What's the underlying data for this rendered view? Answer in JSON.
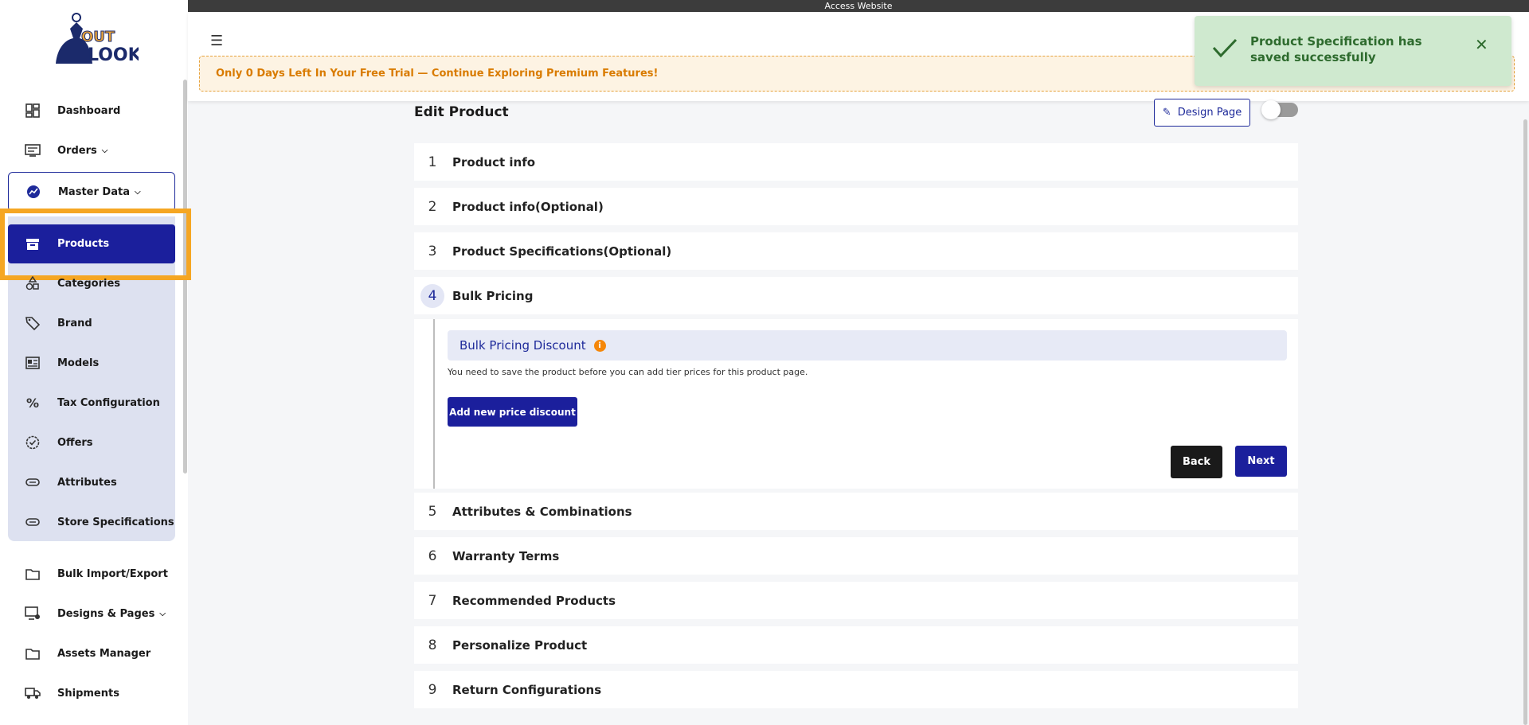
{
  "topbar": {
    "text": "Access Website"
  },
  "sidebar": {
    "items": [
      {
        "label": "Dashboard"
      },
      {
        "label": "Orders"
      },
      {
        "label": "Master Data"
      },
      {
        "label": "Products"
      },
      {
        "label": "Categories"
      },
      {
        "label": "Brand"
      },
      {
        "label": "Models"
      },
      {
        "label": "Tax Configuration"
      },
      {
        "label": "Offers"
      },
      {
        "label": "Attributes"
      },
      {
        "label": "Store Specifications"
      },
      {
        "label": "Bulk Import/Export"
      },
      {
        "label": "Designs & Pages"
      },
      {
        "label": "Assets Manager"
      },
      {
        "label": "Shipments"
      }
    ]
  },
  "banner": {
    "trial_text": "Only 0 Days Left In Your Free Trial — Continue Exploring Premium Features!"
  },
  "toast": {
    "message": "Product Specification has saved successfully"
  },
  "page": {
    "title": "Edit Product",
    "design_button": "Design Page"
  },
  "steps": [
    {
      "num": "1",
      "label": "Product info"
    },
    {
      "num": "2",
      "label": "Product info(Optional)"
    },
    {
      "num": "3",
      "label": "Product Specifications(Optional)"
    },
    {
      "num": "4",
      "label": "Bulk Pricing"
    },
    {
      "num": "5",
      "label": "Attributes & Combinations"
    },
    {
      "num": "6",
      "label": "Warranty Terms"
    },
    {
      "num": "7",
      "label": "Recommended Products"
    },
    {
      "num": "8",
      "label": "Personalize Product"
    },
    {
      "num": "9",
      "label": "Return Configurations"
    }
  ],
  "bulk": {
    "heading": "Bulk Pricing Discount",
    "note": "You need to save the product before you can add tier prices for this product page.",
    "add_button": "Add new price discount",
    "back_button": "Back",
    "next_button": "Next"
  },
  "colors": {
    "primary": "#1b1f9c",
    "warning": "#d97b00",
    "success": "#2e6b2e",
    "highlight": "#f5a623"
  }
}
